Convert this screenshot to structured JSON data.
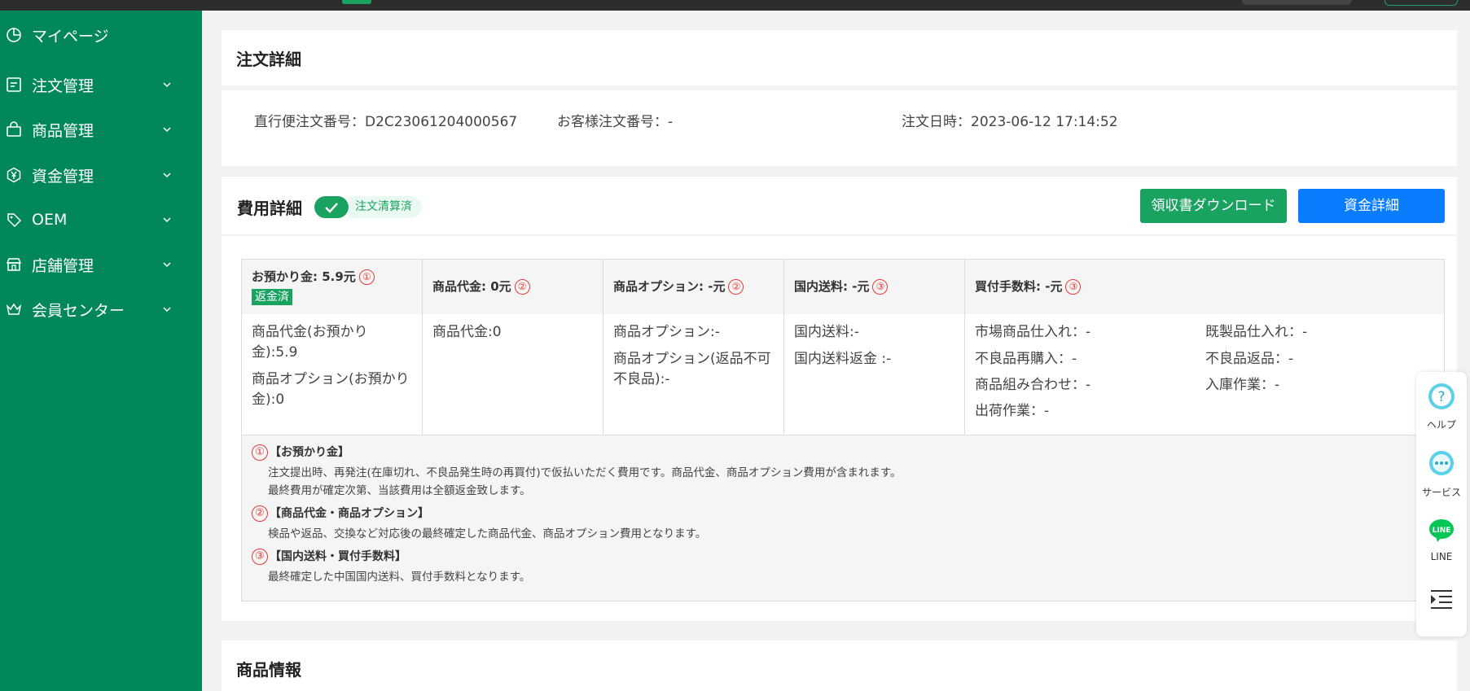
{
  "sidebar": {
    "items": [
      {
        "label": "マイページ",
        "icon": "pie-chart-icon"
      },
      {
        "label": "注文管理",
        "icon": "order-list-icon"
      },
      {
        "label": "商品管理",
        "icon": "shopping-bag-icon"
      },
      {
        "label": "資金管理",
        "icon": "yen-coin-icon"
      },
      {
        "label": "OEM",
        "icon": "tag-icon"
      },
      {
        "label": "店舗管理",
        "icon": "store-icon"
      },
      {
        "label": "会員センター",
        "icon": "crown-icon"
      }
    ]
  },
  "order": {
    "title": "注文詳細",
    "direct_no": "直行便注文番号：D2C23061204000567",
    "customer_no": "お客様注文番号：-",
    "order_date": "注文日時：2023-06-12 17:14:52"
  },
  "fees": {
    "title": "費用詳細",
    "status": "注文清算済",
    "download_btn": "領収書ダウンロード",
    "fund_btn": "資金詳細",
    "columns": [
      {
        "head": "お預かり金: 5.9元",
        "mark": "①",
        "tag": "返金済",
        "lines": [
          "商品代金(お預かり金):5.9",
          "商品オプション(お預かり金):0"
        ]
      },
      {
        "head": "商品代金: 0元",
        "mark": "②",
        "lines": [
          "商品代金:0"
        ]
      },
      {
        "head": "商品オプション: -元",
        "mark": "②",
        "lines": [
          "商品オプション:-",
          "商品オプション(返品不可不良品):-"
        ]
      },
      {
        "head": "国内送料: -元",
        "mark": "③",
        "lines": [
          "国内送料:-",
          "国内送料返金 :-"
        ]
      },
      {
        "head": "買付手数料: -元",
        "mark": "③",
        "lines": [
          "市場商品仕入れ：-",
          "既製品仕入れ：-",
          "不良品再購入：-",
          "不良品返品：-",
          "商品組み合わせ：-",
          "入庫作業：-",
          "出荷作業：-"
        ]
      }
    ],
    "notes": [
      {
        "mark": "①",
        "title": "【お預かり金】",
        "lines": [
          "注文提出時、再発注(在庫切れ、不良品発生時の再買付)で仮払いただく費用です。商品代金、商品オプション費用が含まれます。",
          "最終費用が確定次第、当該費用は全額返金致します。"
        ]
      },
      {
        "mark": "②",
        "title": "【商品代金・商品オプション】",
        "lines": [
          "検品や返品、交換など対応後の最終確定した商品代金、商品オプション費用となります。"
        ]
      },
      {
        "mark": "③",
        "title": "【国内送料・買付手数料】",
        "lines": [
          "最終確定した中国国内送料、買付手数料となります。"
        ]
      }
    ]
  },
  "product": {
    "title": "商品情報"
  },
  "floatbar": {
    "help": "ヘルプ",
    "service": "サービス",
    "line": "LINE",
    "line_logo": "LINE"
  },
  "colors": {
    "sidebar": "#01875a",
    "accent_green": "#1aa260",
    "accent_blue": "#0a7dff",
    "mark_red": "#e53935"
  }
}
